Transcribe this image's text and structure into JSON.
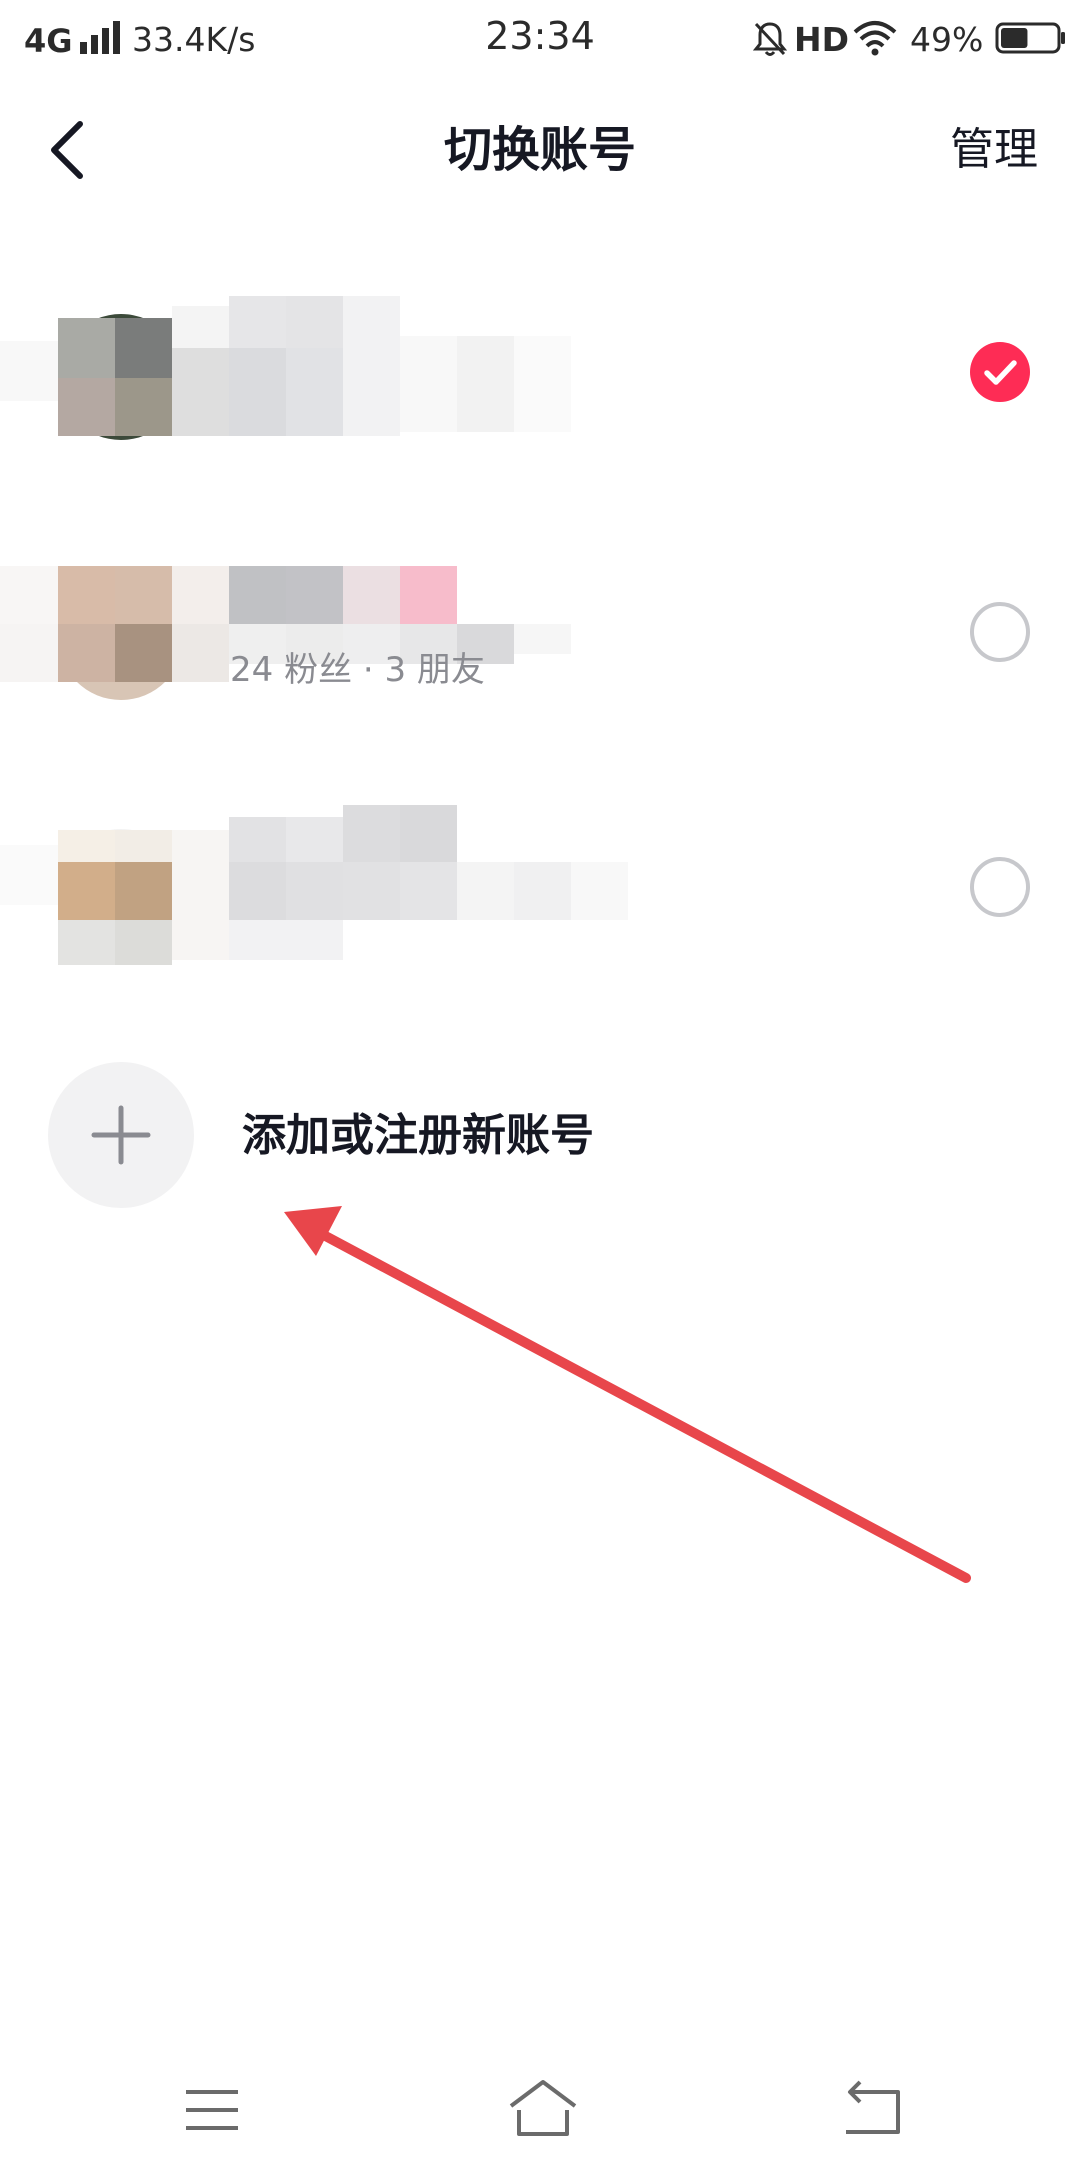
{
  "status_bar": {
    "network": "4G",
    "speed": "33.4K/s",
    "time": "23:34",
    "hd": "HD",
    "battery_percent": "49%",
    "battery_level": 0.49
  },
  "header": {
    "title": "切换账号",
    "manage_label": "管理",
    "back_icon": "chevron-left-icon"
  },
  "accounts": [
    {
      "meta": "",
      "selected": true
    },
    {
      "meta": "24 粉丝 · 3 朋友",
      "selected": false
    },
    {
      "meta": "",
      "selected": false
    }
  ],
  "add_account": {
    "label": "添加或注册新账号",
    "icon": "plus-icon"
  },
  "colors": {
    "accent": "#fe2c55",
    "annotation_arrow": "#e8464b",
    "radio_border": "#c7c8cc",
    "add_bg": "#f2f2f3"
  },
  "system_nav": {
    "menu_icon": "menu-icon",
    "home_icon": "home-icon",
    "back_icon": "back-icon"
  }
}
